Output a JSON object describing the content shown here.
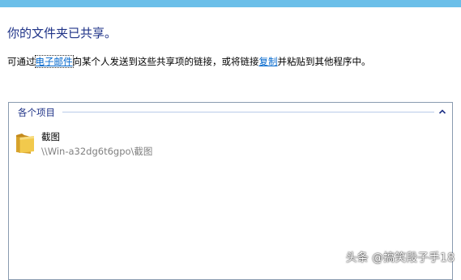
{
  "header": {
    "title": "你的文件夹已共享。"
  },
  "description": {
    "prefix": "可通过",
    "email_link": "电子邮件",
    "middle": "向某个人发送到这些共享项的链接，或将链接",
    "copy_link": "复制",
    "suffix": "并粘贴到其他程序中。"
  },
  "group": {
    "title": "各个项目",
    "collapse_icon": "chevron-up-icon"
  },
  "items": [
    {
      "name": "截图",
      "path": "\\\\Win-a32dg6t6gpo\\截图",
      "icon": "folder-icon"
    }
  ],
  "watermark": {
    "text": "头条 @搞笑段子手18"
  },
  "colors": {
    "accent_bar": "#6bbfe9",
    "title": "#1e3287",
    "link": "#0066cc",
    "path": "#808080"
  }
}
